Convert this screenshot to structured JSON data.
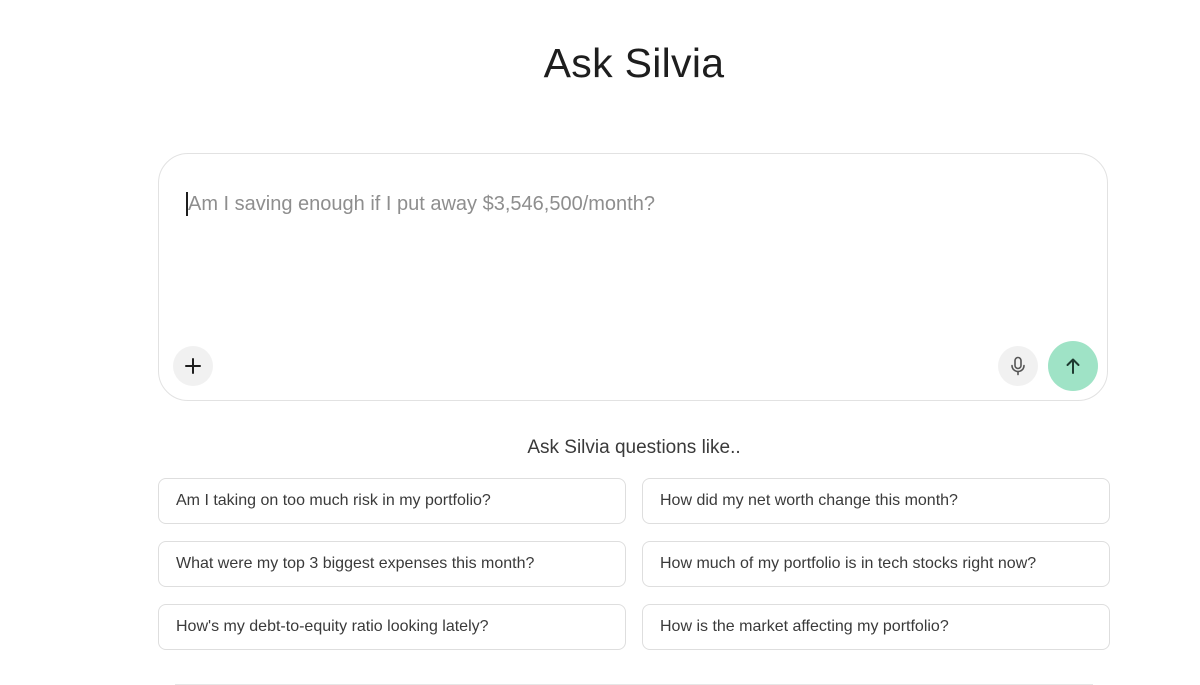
{
  "header": {
    "title": "Ask Silvia"
  },
  "composer": {
    "placeholder": "Am I saving enough if I put away $3,546,500/month?",
    "value": "",
    "attach_icon": "plus-icon",
    "mic_icon": "microphone-icon",
    "send_icon": "arrow-up-icon"
  },
  "suggestions": {
    "heading": "Ask Silvia questions like..",
    "items": [
      "Am I taking on too much risk in my portfolio?",
      "How did my net worth change this month?",
      "What were my top 3 biggest expenses this month?",
      "How much of my portfolio is in tech stocks right now?",
      "How's my debt-to-equity ratio looking lately?",
      "How is the market affecting my portfolio?"
    ]
  },
  "colors": {
    "send_button": "#9fe3c6",
    "icon_button": "#f1f1f1",
    "border": "#e2e2e2"
  }
}
